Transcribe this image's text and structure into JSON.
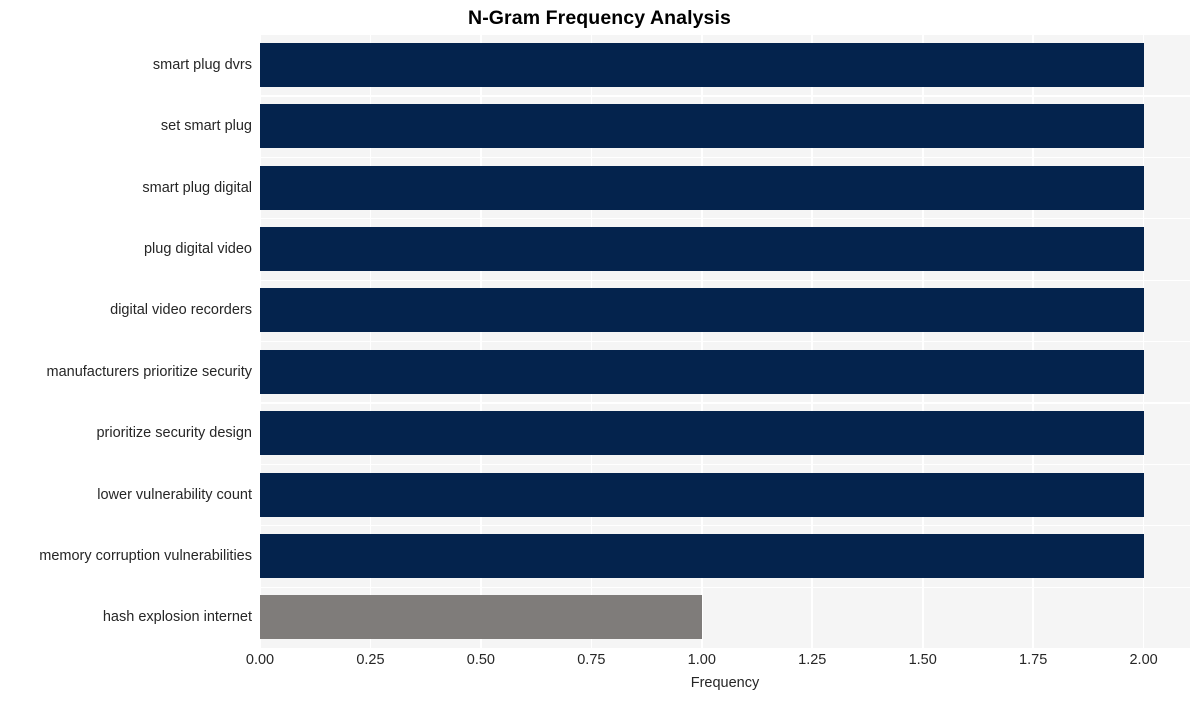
{
  "chart_data": {
    "type": "bar",
    "orientation": "horizontal",
    "title": "N-Gram Frequency Analysis",
    "xlabel": "Frequency",
    "ylabel": "",
    "xlim": [
      0,
      2.105
    ],
    "xticks": [
      "0.00",
      "0.25",
      "0.50",
      "0.75",
      "1.00",
      "1.25",
      "1.50",
      "1.75",
      "2.00"
    ],
    "xtick_values": [
      0,
      0.25,
      0.5,
      0.75,
      1.0,
      1.25,
      1.5,
      1.75,
      2.0
    ],
    "grid": true,
    "legend": null,
    "categories": [
      "smart plug dvrs",
      "set smart plug",
      "smart plug digital",
      "plug digital video",
      "digital video recorders",
      "manufacturers prioritize security",
      "prioritize security design",
      "lower vulnerability count",
      "memory corruption vulnerabilities",
      "hash explosion internet"
    ],
    "values": [
      2,
      2,
      2,
      2,
      2,
      2,
      2,
      2,
      2,
      1
    ],
    "bar_colors": [
      "#04234d",
      "#04234d",
      "#04234d",
      "#04234d",
      "#04234d",
      "#04234d",
      "#04234d",
      "#04234d",
      "#04234d",
      "#7f7c7a"
    ],
    "plot_background": "#f5f5f5",
    "figure_background": "#ffffff",
    "gridline_color": "#ffffff"
  }
}
